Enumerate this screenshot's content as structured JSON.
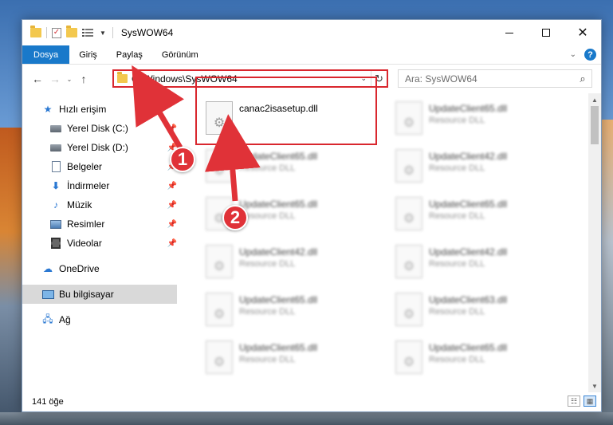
{
  "window": {
    "title": "SysWOW64",
    "controls": {
      "minimize": "minimize",
      "maximize": "maximize",
      "close": "✕"
    }
  },
  "ribbon": {
    "tabs": [
      "Dosya",
      "Giriş",
      "Paylaş",
      "Görünüm"
    ],
    "expand_icon": "⌄",
    "help": "?"
  },
  "nav": {
    "back": "←",
    "forward": "→",
    "recent": "⌄",
    "up": "↑",
    "address": "C:\\Windows\\SysWOW64",
    "address_drop": "⌄",
    "refresh": "↻",
    "search_placeholder": "Ara: SysWOW64",
    "search_icon": "⌕"
  },
  "sidebar": {
    "quick_access": "Hızlı erişim",
    "items": [
      {
        "label": "Yerel Disk (C:)",
        "icon": "disk-icon"
      },
      {
        "label": "Yerel Disk (D:)",
        "icon": "disk-icon"
      },
      {
        "label": "Belgeler",
        "icon": "document-icon"
      },
      {
        "label": "İndirmeler",
        "icon": "download-icon"
      },
      {
        "label": "Müzik",
        "icon": "music-icon"
      },
      {
        "label": "Resimler",
        "icon": "pictures-icon"
      },
      {
        "label": "Videolar",
        "icon": "video-icon"
      }
    ],
    "onedrive": "OneDrive",
    "this_pc": "Bu bilgisayar",
    "network": "Ağ",
    "pin": "📌"
  },
  "files": {
    "highlighted": {
      "name": "canac2isasetup.dll",
      "type": ""
    },
    "left_column": [
      {
        "name": "UpdateClient65.dll",
        "type": "Resource DLL"
      },
      {
        "name": "UpdateClient65.dll",
        "type": "Resource DLL"
      },
      {
        "name": "UpdateClient42.dll",
        "type": "Resource DLL"
      },
      {
        "name": "UpdateClient65.dll",
        "type": "Resource DLL"
      },
      {
        "name": "UpdateClient65.dll",
        "type": "Resource DLL"
      }
    ],
    "right_column": [
      {
        "name": "UpdateClient65.dll",
        "type": "Resource DLL"
      },
      {
        "name": "UpdateClient42.dll",
        "type": "Resource DLL"
      },
      {
        "name": "UpdateClient65.dll",
        "type": "Resource DLL"
      },
      {
        "name": "UpdateClient42.dll",
        "type": "Resource DLL"
      },
      {
        "name": "UpdateClient63.dll",
        "type": "Resource DLL"
      },
      {
        "name": "UpdateClient65.dll",
        "type": "Resource DLL"
      }
    ]
  },
  "status": {
    "count": "141 öğe"
  },
  "markers": [
    "1",
    "2"
  ],
  "colors": {
    "accent": "#1979ca",
    "highlight": "#d9272e",
    "marker": "#e03238"
  }
}
